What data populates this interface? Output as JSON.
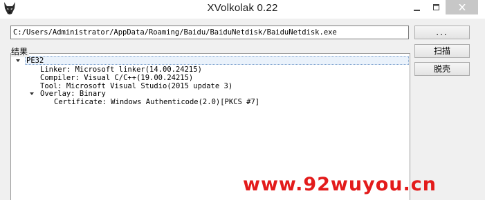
{
  "window": {
    "title": "XVolkolak 0.22",
    "icon": "wolf-head-icon",
    "controls": [
      "minimize-icon",
      "maximize-icon",
      "close-icon"
    ]
  },
  "path_input": {
    "value": "C:/Users/Administrator/AppData/Roaming/Baidu/BaiduNetdisk/BaiduNetdisk.exe"
  },
  "buttons": {
    "browse_label": "...",
    "scan_label": "扫描",
    "unpack_label": "脱壳"
  },
  "results": {
    "group_label": "结果",
    "tree": {
      "root": "PE32",
      "items": [
        "Linker: Microsoft linker(14.00.24215)",
        "Compiler: Visual C/C++(19.00.24215)",
        "Tool: Microsoft Visual Studio(2015 update 3)"
      ],
      "overlay": {
        "label": "Overlay: Binary",
        "items": [
          "Certificate: Windows Authenticode(2.0)[PKCS #7]"
        ]
      }
    }
  },
  "watermark": {
    "text": "www.92wuyou.cn",
    "color": "#e31b1b"
  },
  "colors": {
    "selection_border": "#7da2ce",
    "selection_fill": "#eaf2fb",
    "close_button_bg": "#c7c7c7"
  }
}
